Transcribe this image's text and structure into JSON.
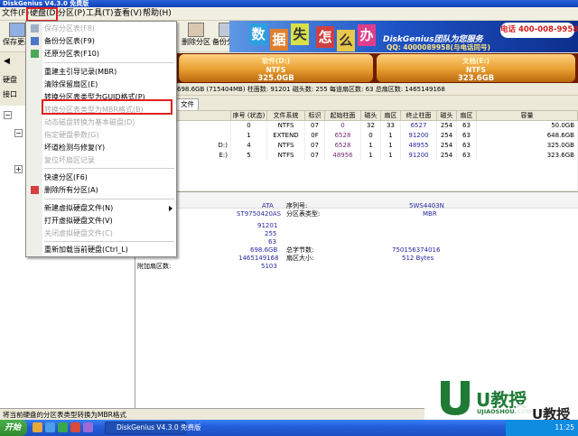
{
  "app": {
    "title": "DiskGenius V4.3.0 免费版"
  },
  "menubar": [
    "文件(F)",
    "硬盘(D)",
    "分区(P)",
    "工具(T)",
    "查看(V)",
    "帮助(H)"
  ],
  "toolbar": [
    {
      "label": "保存更改",
      "icon": "save-icon"
    },
    {
      "label": "化",
      "icon": "format-icon"
    },
    {
      "label": "删除分区",
      "icon": "delete-partition-icon"
    },
    {
      "label": "备份分区",
      "icon": "backup-partition-icon"
    }
  ],
  "banner": {
    "tiles": [
      "数",
      "据",
      "失",
      "怎",
      "么",
      "办"
    ],
    "brand": "DiskGenius团队为您服务",
    "qq": "QQ: 4000089958(与电话同号)",
    "phone": "电话 400-008-9958"
  },
  "side": {
    "disk_label": "硬盘",
    "iface_label": "接口"
  },
  "volumes": [
    {
      "name": "软件(D:)",
      "fs": "NTFS",
      "size": "325.0GB"
    },
    {
      "name": "文档(E:)",
      "fs": "NTFS",
      "size": "323.6GB"
    }
  ],
  "disk_info": "698.6GB (715404MB)   柱面数: 91201   磁头数: 255   每道扇区数: 63   总扇区数: 1465149168",
  "tab_label": "文件",
  "table": {
    "headers": [
      "",
      "序号 (状态)",
      "文件系统",
      "标识",
      "起始柱面",
      "磁头",
      "扇区",
      "终止柱面",
      "磁头",
      "扇区",
      "容量"
    ],
    "rows": [
      [
        "",
        "0",
        "NTFS",
        "07",
        "0",
        "32",
        "33",
        "6527",
        "254",
        "63",
        "50.0GB"
      ],
      [
        "",
        "1",
        "EXTEND",
        "0F",
        "6528",
        "0",
        "1",
        "91200",
        "254",
        "63",
        "648.6GB"
      ],
      [
        "D:)",
        "4",
        "NTFS",
        "07",
        "6528",
        "1",
        "1",
        "48955",
        "254",
        "63",
        "325.0GB"
      ],
      [
        "E:)",
        "5",
        "NTFS",
        "07",
        "48956",
        "1",
        "1",
        "91200",
        "254",
        "63",
        "323.6GB"
      ]
    ]
  },
  "details": {
    "left_values": [
      "ATA",
      "ST9750420AS"
    ],
    "right_labels": [
      "序列号:",
      "分区表类型:"
    ],
    "right_values": [
      "5WS4403N",
      "MBR"
    ],
    "geometry": [
      "91201",
      "255",
      "63",
      "698.6GB",
      "1465149168",
      "5103"
    ],
    "totals_labels": [
      "总字节数:",
      "扇区大小:"
    ],
    "totals_values": [
      "750156374016",
      "512 Bytes"
    ],
    "extra_label": "附加扇区数:"
  },
  "menu": {
    "items": [
      {
        "label": "保存分区表(F8)",
        "enabled": false
      },
      {
        "label": "备份分区表(F9)",
        "enabled": true
      },
      {
        "label": "还原分区表(F10)",
        "enabled": true
      },
      {
        "label": "重建主引导记录(MBR)",
        "enabled": true
      },
      {
        "label": "清除保留扇区(E)",
        "enabled": true
      },
      {
        "label": "转换分区表类型为GUID格式(P)",
        "enabled": true
      },
      {
        "label": "转换分区表类型为MBR格式(B)",
        "enabled": false
      },
      {
        "label": "动态磁盘转换为基本磁盘(D)",
        "enabled": false
      },
      {
        "label": "指定硬盘参数(G)",
        "enabled": false
      },
      {
        "label": "坏道检测与修复(Y)",
        "enabled": true
      },
      {
        "label": "复位坏扇区记录",
        "enabled": false
      },
      {
        "label": "快速分区(F6)",
        "enabled": true
      },
      {
        "label": "删除所有分区(A)",
        "enabled": true
      },
      {
        "label": "新建虚拟硬盘文件(N)",
        "enabled": true
      },
      {
        "label": "打开虚拟硬盘文件(V)",
        "enabled": true
      },
      {
        "label": "关闭虚拟硬盘文件(C)",
        "enabled": false
      },
      {
        "label": "重新加载当前硬盘(Ctrl_L)",
        "enabled": true
      }
    ]
  },
  "status_text": "将当前硬盘的分区表类型转换为MBR格式",
  "watermark": {
    "brand": "U教授",
    "url": "UJIAOSHOU.COM",
    "brand2": "U教授"
  },
  "taskbar": {
    "start": "开始",
    "task": "DiskGenius V4.3.0 免费版",
    "clock": "11:25"
  },
  "colors": {
    "highlight": "#e02020",
    "volume": "#e89e30",
    "banner": "#1d52c4"
  }
}
